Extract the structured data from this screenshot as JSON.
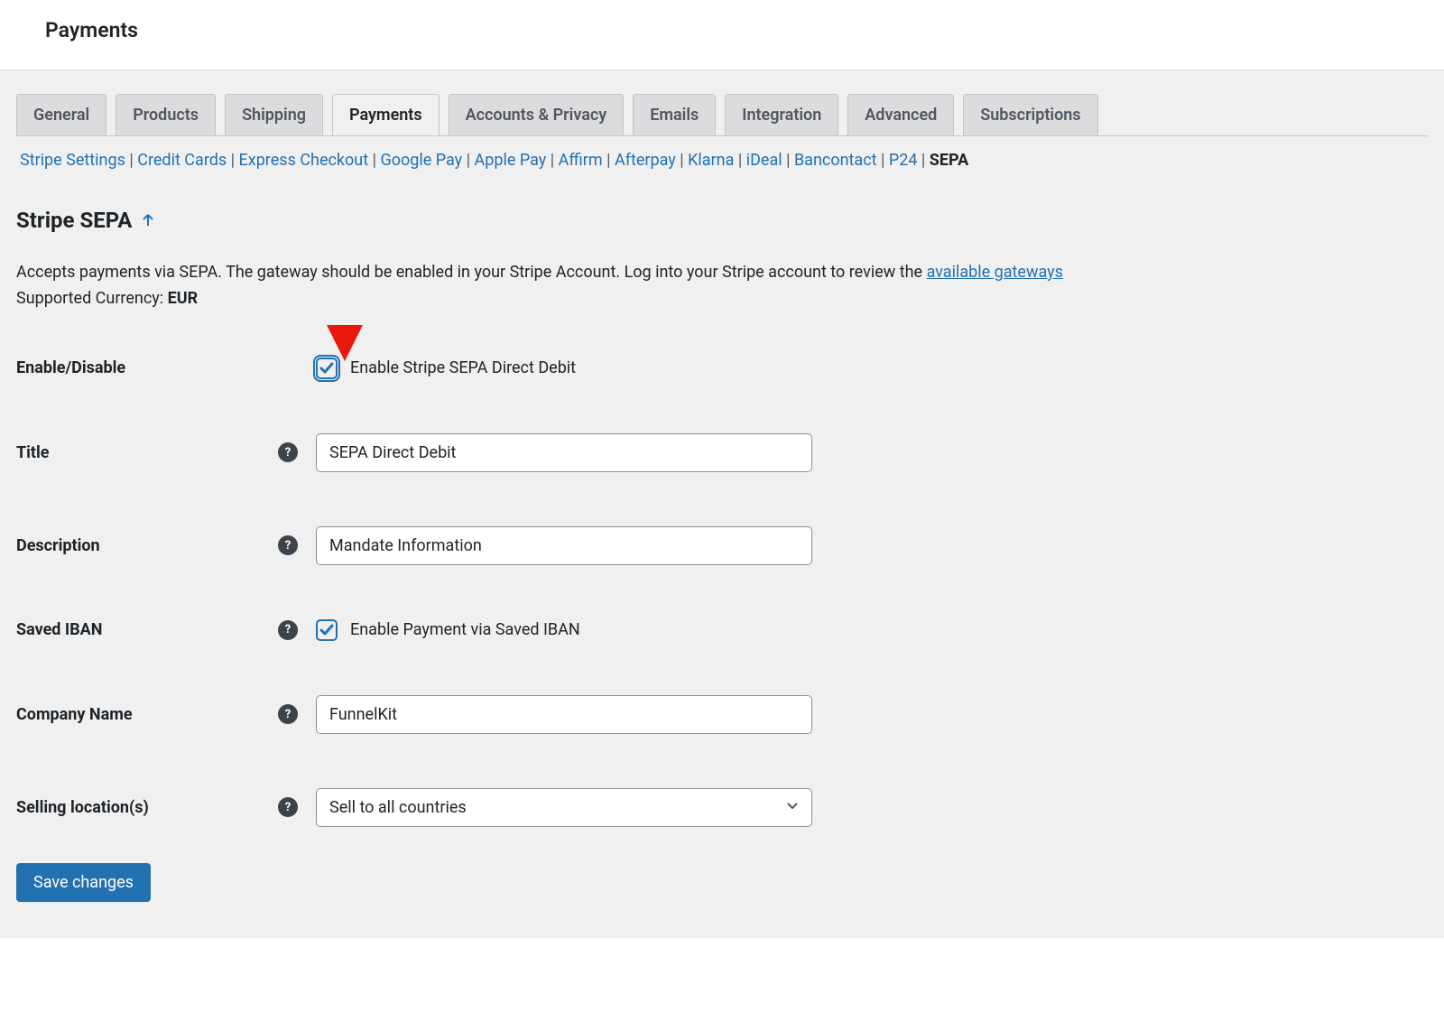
{
  "header": {
    "title": "Payments"
  },
  "tabs": [
    {
      "id": "general",
      "label": "General",
      "active": false
    },
    {
      "id": "products",
      "label": "Products",
      "active": false
    },
    {
      "id": "shipping",
      "label": "Shipping",
      "active": false
    },
    {
      "id": "payments",
      "label": "Payments",
      "active": true
    },
    {
      "id": "accounts",
      "label": "Accounts & Privacy",
      "active": false
    },
    {
      "id": "emails",
      "label": "Emails",
      "active": false
    },
    {
      "id": "integration",
      "label": "Integration",
      "active": false
    },
    {
      "id": "advanced",
      "label": "Advanced",
      "active": false
    },
    {
      "id": "subscriptions",
      "label": "Subscriptions",
      "active": false
    }
  ],
  "subsub": [
    {
      "label": "Stripe Settings",
      "current": false
    },
    {
      "label": "Credit Cards",
      "current": false
    },
    {
      "label": "Express Checkout",
      "current": false
    },
    {
      "label": "Google Pay",
      "current": false
    },
    {
      "label": "Apple Pay",
      "current": false
    },
    {
      "label": "Affirm",
      "current": false
    },
    {
      "label": "Afterpay",
      "current": false
    },
    {
      "label": "Klarna",
      "current": false
    },
    {
      "label": "iDeal",
      "current": false
    },
    {
      "label": "Bancontact",
      "current": false
    },
    {
      "label": "P24",
      "current": false
    },
    {
      "label": "SEPA",
      "current": true
    }
  ],
  "section": {
    "heading": "Stripe SEPA",
    "desc_prefix": "Accepts payments via SEPA. The gateway should be enabled in your Stripe Account. Log into your Stripe account to review the ",
    "desc_link": "available gateways",
    "desc_line2_prefix": "Supported Currency: ",
    "desc_currency": "EUR"
  },
  "form": {
    "enable": {
      "label": "Enable/Disable",
      "text": "Enable Stripe SEPA Direct Debit",
      "checked": true
    },
    "title": {
      "label": "Title",
      "value": "SEPA Direct Debit"
    },
    "description": {
      "label": "Description",
      "value": "Mandate Information"
    },
    "saved_iban": {
      "label": "Saved IBAN",
      "text": "Enable Payment via Saved IBAN",
      "checked": true
    },
    "company": {
      "label": "Company Name",
      "value": "FunnelKit"
    },
    "selling": {
      "label": "Selling location(s)",
      "value": "Sell to all countries"
    },
    "save_btn": "Save changes"
  }
}
